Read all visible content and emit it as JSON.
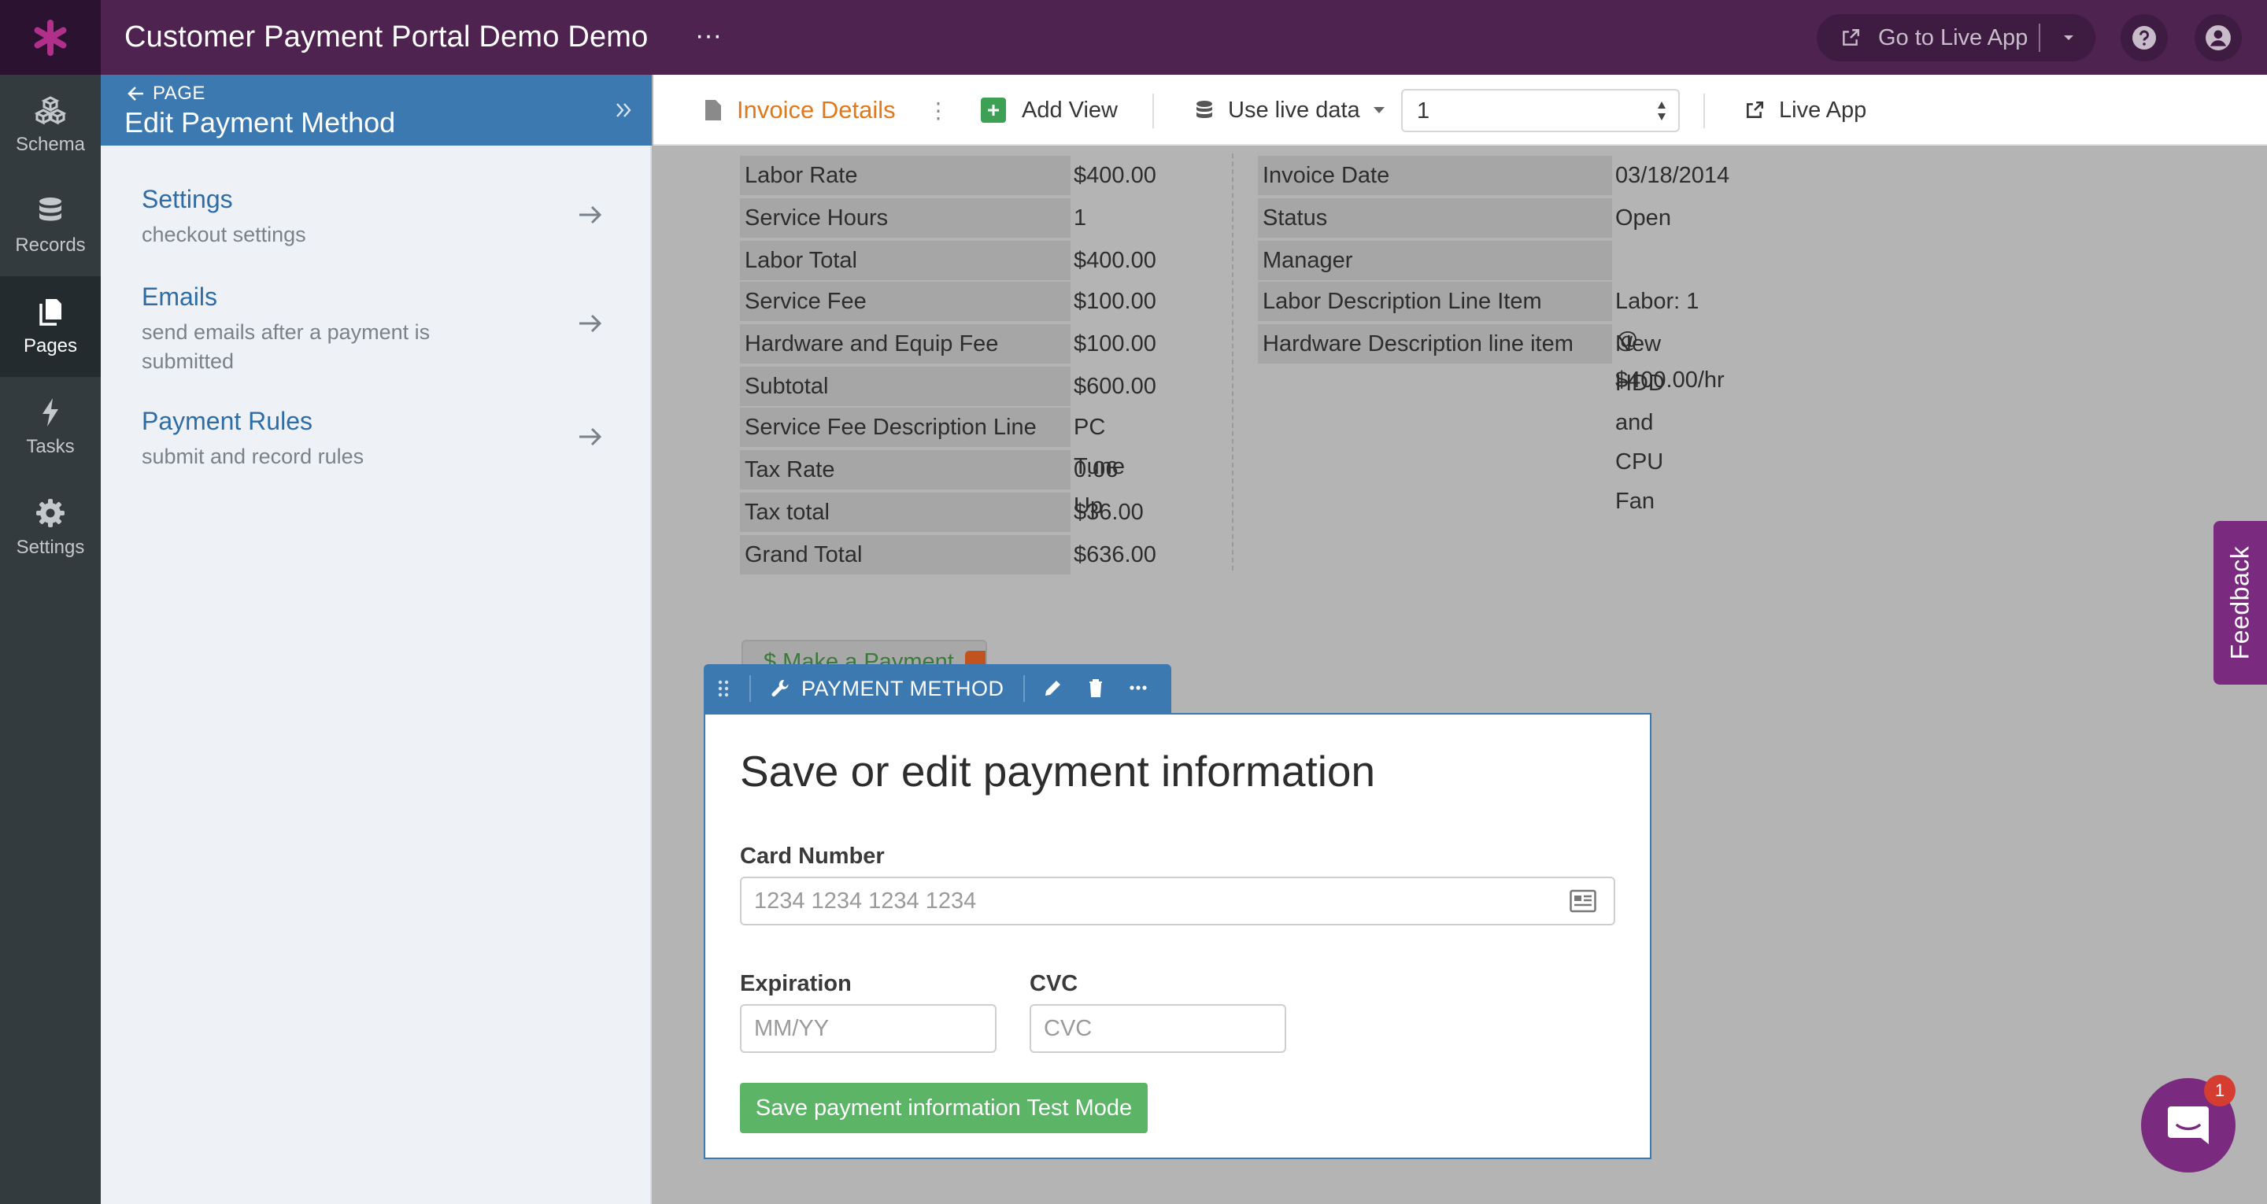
{
  "app": {
    "title": "Customer Payment Portal Demo Demo",
    "more_label": "···",
    "go_live_label": "Go to Live App",
    "accent": "#4f2350"
  },
  "rail": {
    "items": [
      {
        "label": "Schema",
        "icon": "schema-icon"
      },
      {
        "label": "Records",
        "icon": "database-icon"
      },
      {
        "label": "Pages",
        "icon": "pages-icon",
        "active": true
      },
      {
        "label": "Tasks",
        "icon": "bolt-icon"
      },
      {
        "label": "Settings",
        "icon": "gear-icon"
      }
    ]
  },
  "panel": {
    "back_label": "PAGE",
    "title": "Edit Payment Method",
    "items": [
      {
        "title": "Settings",
        "desc": "checkout settings"
      },
      {
        "title": "Emails",
        "desc": "send emails after a payment is submitted"
      },
      {
        "title": "Payment Rules",
        "desc": "submit and record rules"
      }
    ]
  },
  "toolbar": {
    "view_name": "Invoice Details",
    "kebab": "⋮",
    "add_view": "Add View",
    "live_data": "Use live data",
    "record_value": "1",
    "live_app": "Live App"
  },
  "invoice": {
    "left_rows": [
      {
        "label": "Labor Rate",
        "value": "$400.00"
      },
      {
        "label": "Service Hours",
        "value": "1"
      },
      {
        "label": "Labor Total",
        "value": "$400.00"
      },
      {
        "label": "Service Fee",
        "value": "$100.00"
      },
      {
        "label": "Hardware and Equip Fee",
        "value": "$100.00"
      },
      {
        "label": "Subtotal",
        "value": "$600.00"
      },
      {
        "label": "Service Fee Description Line",
        "value": "PC Tune Up"
      },
      {
        "label": "Tax Rate",
        "value": "0.06"
      },
      {
        "label": "Tax total",
        "value": "$36.00"
      },
      {
        "label": "Grand Total",
        "value": "$636.00"
      }
    ],
    "right_rows": [
      {
        "label": "Invoice Date",
        "value": "03/18/2014"
      },
      {
        "label": "Status",
        "value": "Open"
      },
      {
        "label": "Manager",
        "value": ""
      },
      {
        "label": "Labor Description Line Item",
        "value": "Labor: 1 @ $400.00/hr"
      },
      {
        "label": "Hardware Description line item",
        "value": "New HDD and CPU Fan"
      }
    ],
    "make_payment": "$ Make a Payment"
  },
  "view": {
    "label": "PAYMENT METHOD",
    "more": "···"
  },
  "form": {
    "title": "Save or edit payment information",
    "card_label": "Card Number",
    "card_placeholder": "1234 1234 1234 1234",
    "exp_label": "Expiration",
    "exp_placeholder": "MM/YY",
    "cvc_label": "CVC",
    "cvc_placeholder": "CVC",
    "submit": "Save payment information Test Mode"
  },
  "feedback": "Feedback",
  "chat": {
    "badge": "1"
  }
}
